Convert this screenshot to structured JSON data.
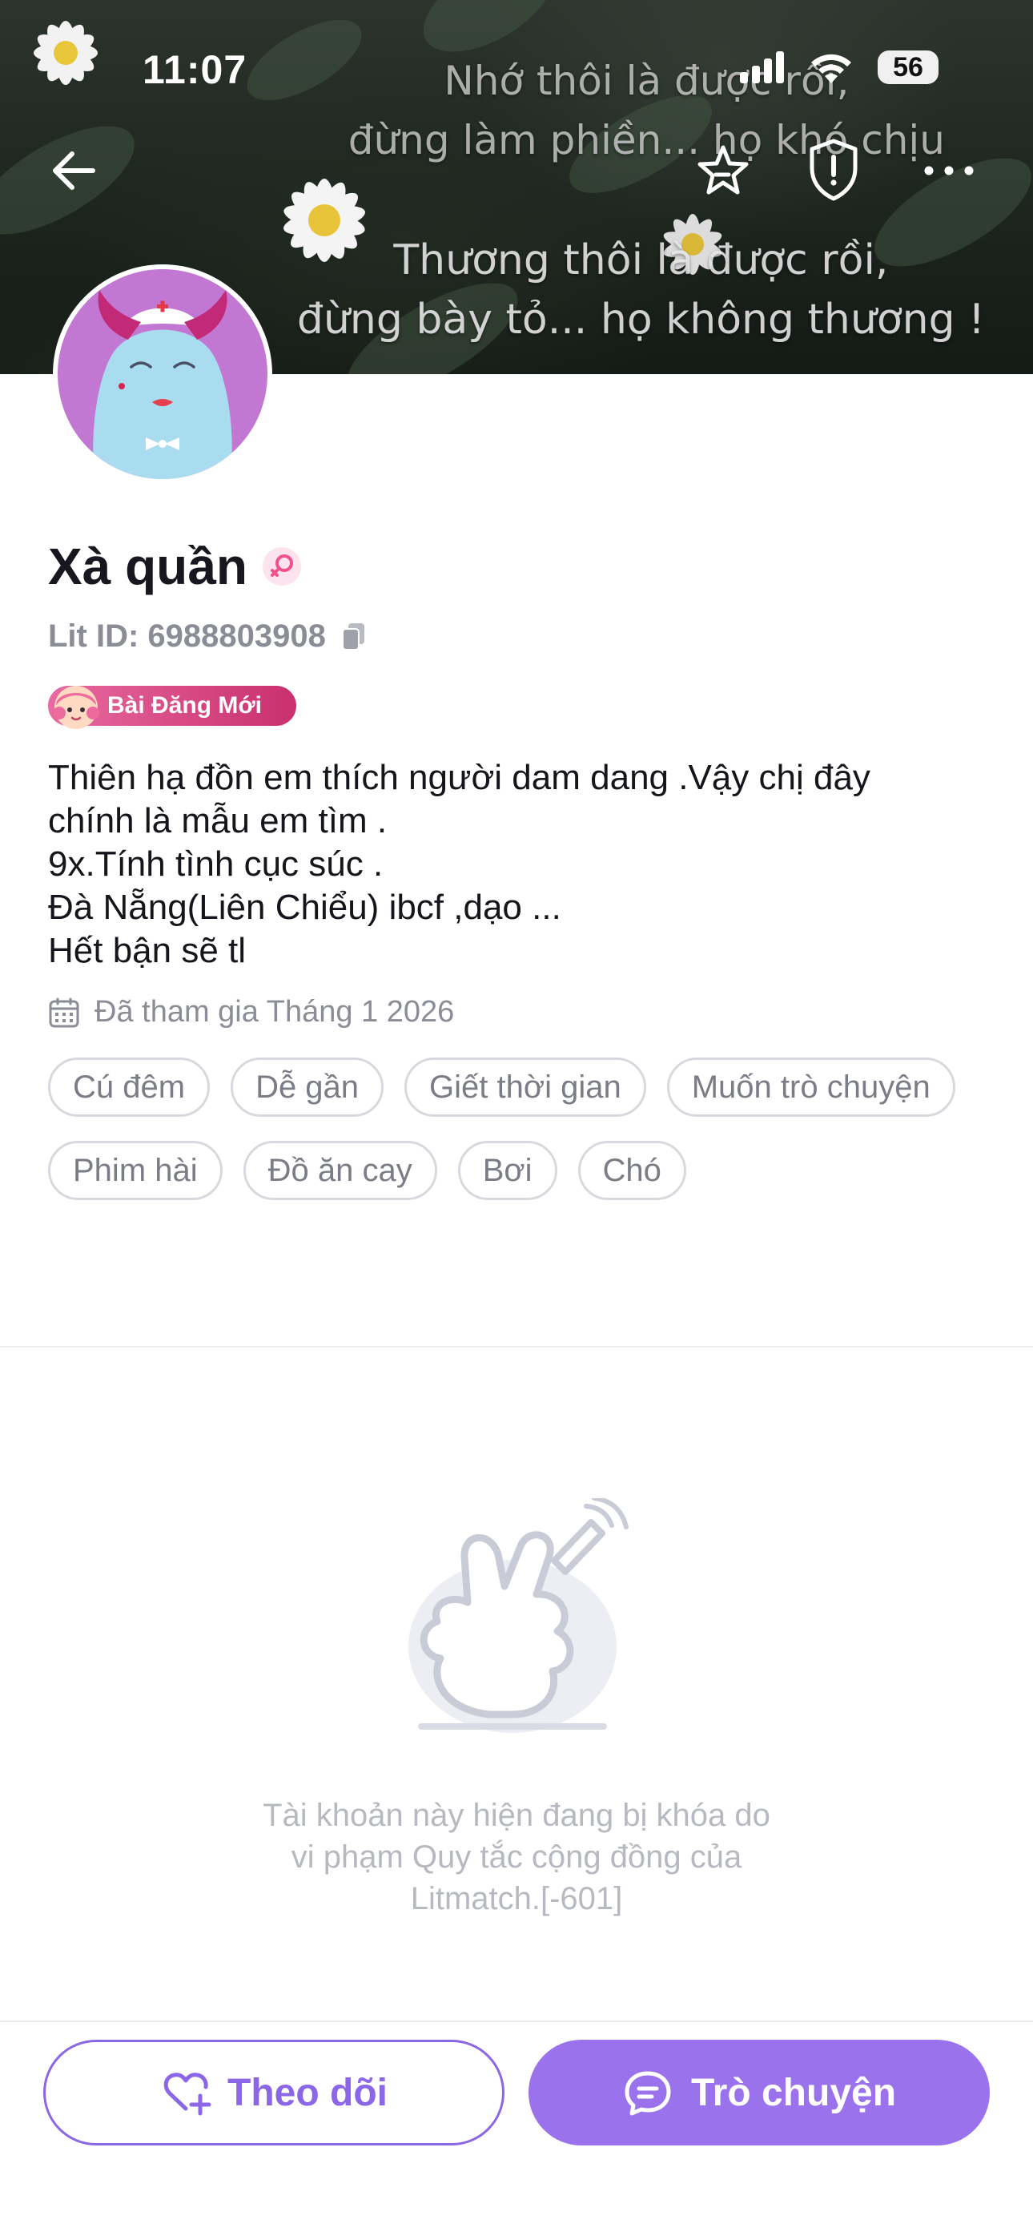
{
  "status_bar": {
    "time": "11:07",
    "battery": "56"
  },
  "cover": {
    "text_top": "Nhớ thôi là được rồi,\nđừng làm phiền... họ khó chịu",
    "text_bottom": "Thương thôi là được rồi,\nđừng bày tỏ... họ không thương !"
  },
  "nav": {
    "back_icon": "arrow-left-icon",
    "star_icon": "star-icon",
    "report_icon": "shield-alert-icon",
    "more_icon": "more-dots-icon"
  },
  "profile": {
    "name": "Xà quần",
    "gender_icon": "female-icon",
    "lit_id": "Lit ID: 6988803908",
    "new_post_badge": "Bài Đăng Mới",
    "bio": "Thiên hạ đồn em thích người  dam dang .Vậy chị đây\nchính là mẫu em tìm .\n9x.Tính tình cục súc .\nĐà Nẵng(Liên Chiểu) ibcf ,dạo ...\nHết bận sẽ tl",
    "joined": "Đã tham gia Tháng 1 2026",
    "tags": [
      "Cú đêm",
      "Dễ gần",
      "Giết thời gian",
      "Muốn trò chuyện",
      "Phim hài",
      "Đồ ăn cay",
      "Bơi",
      "Chó"
    ]
  },
  "locked": {
    "message": "Tài khoản này hiện đang bị khóa do\nvi phạm Quy tắc cộng đồng của\nLitmatch.[-601]"
  },
  "actions": {
    "follow_label": "Theo dõi",
    "chat_label": "Trò chuyện"
  },
  "colors": {
    "accent": "#9a72ec",
    "accent_outline": "#8b66e6",
    "badge": "#d6407f",
    "avatar_bg": "#c278d3"
  }
}
